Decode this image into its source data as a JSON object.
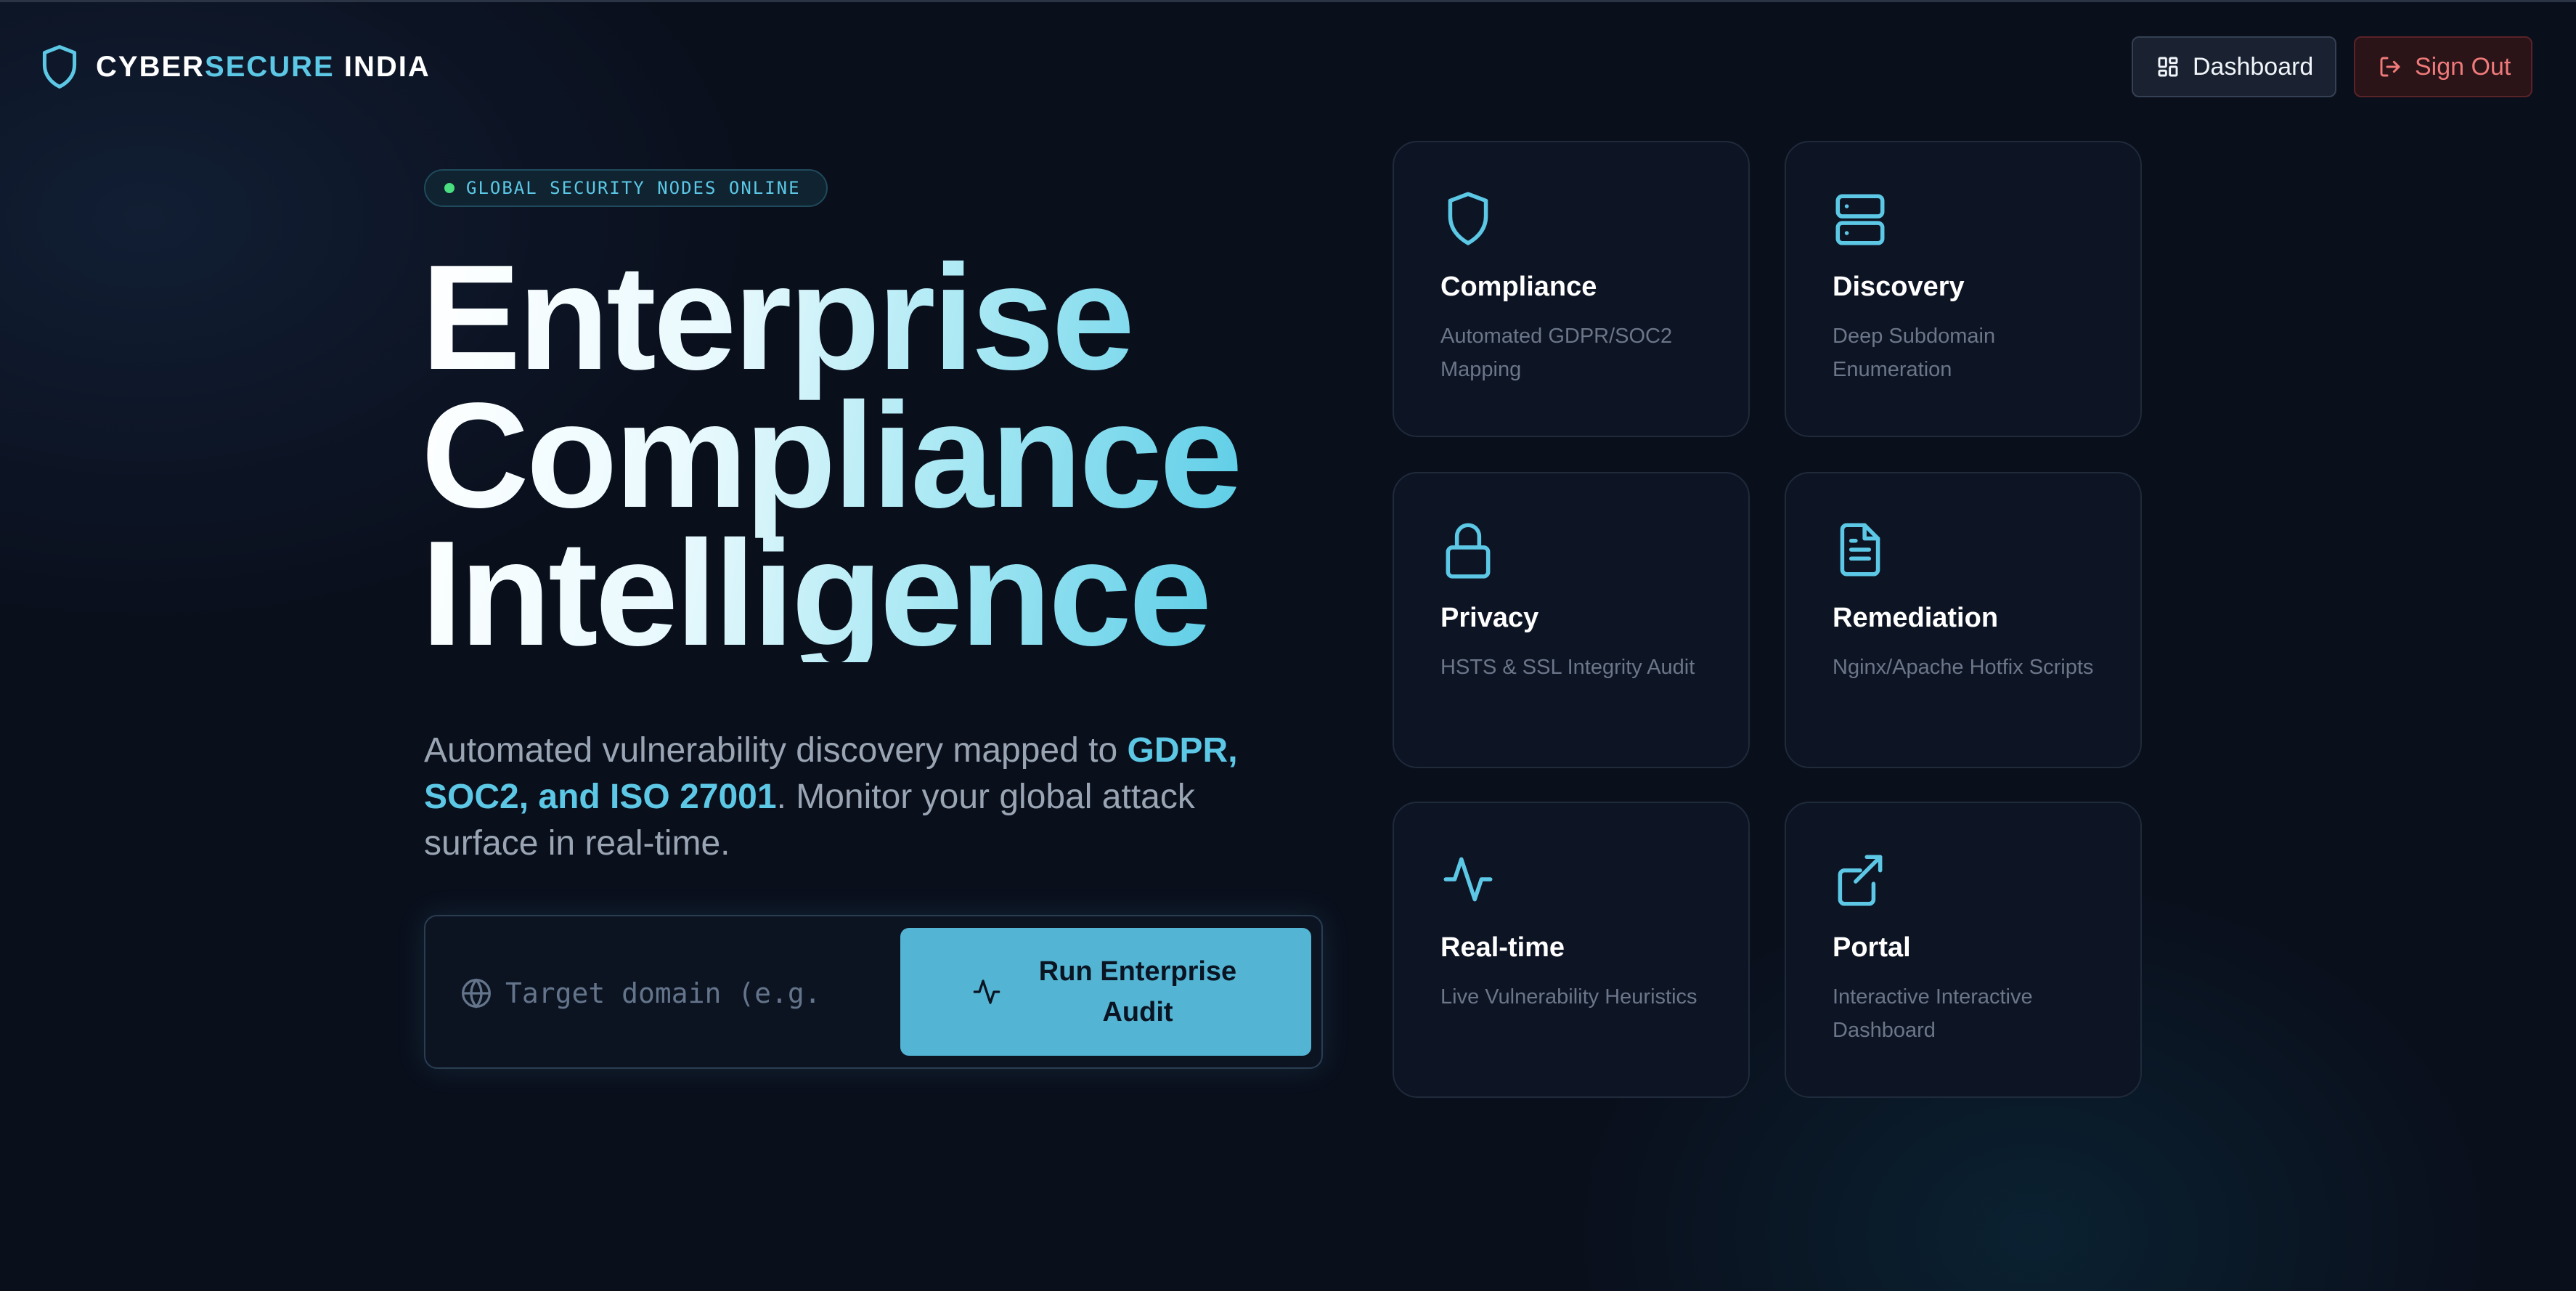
{
  "brand": {
    "part1": "CYBER",
    "part2": "SECURE",
    "part3": " INDIA"
  },
  "header": {
    "dashboard_label": "Dashboard",
    "signout_label": "Sign Out"
  },
  "hero": {
    "status": "GLOBAL SECURITY NODES ONLINE",
    "headline": [
      "Enterprise",
      "Compliance",
      "Intelligence"
    ],
    "subtitle_pre": "Automated vulnerability discovery mapped to ",
    "subtitle_highlight": "GDPR, SOC2, and ISO 27001",
    "subtitle_post": ". Monitor your global attack surface in real-time."
  },
  "audit": {
    "placeholder": "Target domain (e.g.",
    "value": "",
    "button_label": "Run Enterprise Audit"
  },
  "features": [
    {
      "title": "Compliance",
      "desc": "Automated GDPR/SOC2 Mapping",
      "icon": "shield-icon"
    },
    {
      "title": "Discovery",
      "desc": "Deep Subdomain Enumeration",
      "icon": "server-icon"
    },
    {
      "title": "Privacy",
      "desc": "HSTS & SSL Integrity Audit",
      "icon": "lock-icon"
    },
    {
      "title": "Remediation",
      "desc": "Nginx/Apache Hotfix Scripts",
      "icon": "file-text-icon"
    },
    {
      "title": "Real-time",
      "desc": "Live Vulnerability Heuristics",
      "icon": "activity-icon"
    },
    {
      "title": "Portal",
      "desc": "Interactive Interactive Dashboard",
      "icon": "external-link-icon"
    }
  ],
  "colors": {
    "accent": "#5cc8e6",
    "background": "#0a0f1c",
    "button": "#53b5d3",
    "danger": "#f07a7a",
    "online": "#4ade80"
  }
}
